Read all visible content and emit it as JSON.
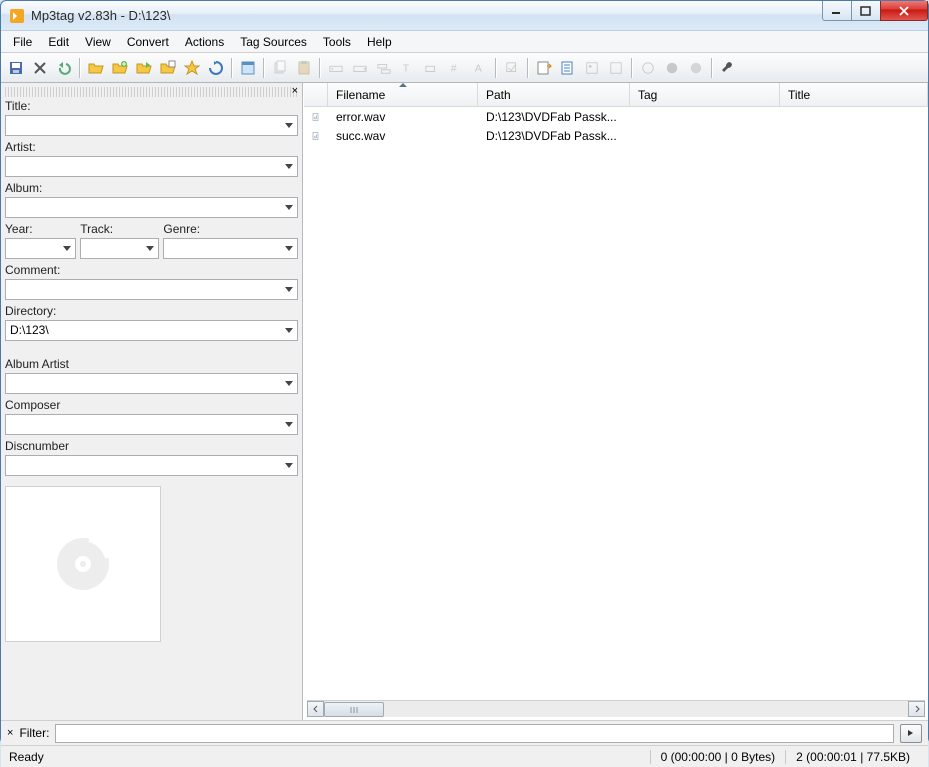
{
  "window": {
    "title": "Mp3tag v2.83h  -  D:\\123\\"
  },
  "menu": [
    "File",
    "Edit",
    "View",
    "Convert",
    "Actions",
    "Tag Sources",
    "Tools",
    "Help"
  ],
  "tagpanel": {
    "title_lbl": "Title:",
    "title_val": "",
    "artist_lbl": "Artist:",
    "artist_val": "",
    "album_lbl": "Album:",
    "album_val": "",
    "year_lbl": "Year:",
    "year_val": "",
    "track_lbl": "Track:",
    "track_val": "",
    "genre_lbl": "Genre:",
    "genre_val": "",
    "comment_lbl": "Comment:",
    "comment_val": "",
    "directory_lbl": "Directory:",
    "directory_val": "D:\\123\\",
    "albumartist_lbl": "Album Artist",
    "albumartist_val": "",
    "composer_lbl": "Composer",
    "composer_val": "",
    "discnumber_lbl": "Discnumber",
    "discnumber_val": ""
  },
  "columns": {
    "filename": "Filename",
    "path": "Path",
    "tag": "Tag",
    "title": "Title"
  },
  "files": [
    {
      "name": "error.wav",
      "path": "D:\\123\\DVDFab Passk..."
    },
    {
      "name": "succ.wav",
      "path": "D:\\123\\DVDFab Passk..."
    }
  ],
  "filter": {
    "label": "Filter:",
    "value": ""
  },
  "status": {
    "ready": "Ready",
    "sel": "0 (00:00:00 | 0 Bytes)",
    "total": "2 (00:00:01 | 77.5KB)"
  }
}
